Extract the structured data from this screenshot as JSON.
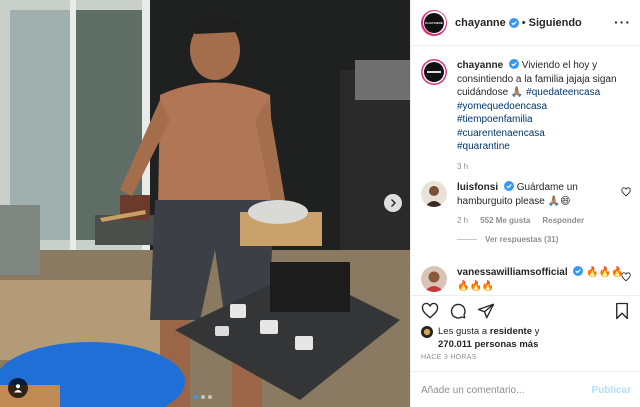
{
  "post": {
    "author": "chayanne",
    "avatar_text": "CHAYANNE",
    "follow_status": "Siguiendo",
    "separator": "•",
    "more_label": "···",
    "caption": {
      "author": "chayanne",
      "text": "Viviendo el hoy y consintiendo a la familia jajaja sigan cuidándose 🙏🏽",
      "hashtags": [
        "#quedateencasa",
        "#yomequedoencasa",
        "#tiempoenfamilia",
        "#cuarentenaencasa",
        "#quarantine"
      ],
      "time": "3 h"
    }
  },
  "comments": [
    {
      "author": "luisfonsi",
      "verified": true,
      "text": "Guárdame un hamburguito please 🙏🏽😄",
      "time": "2 h",
      "likes": "552 Me gusta",
      "reply_label": "Responder",
      "view_replies": "Ver respuestas (31)"
    },
    {
      "author": "vanessawilliamsofficial",
      "verified": true,
      "text": "🔥🔥🔥🔥🔥🔥"
    }
  ],
  "actions": {
    "liked_by_prefix": "Les gusta a",
    "liked_by_user": "residente",
    "liked_by_connector": "y",
    "liked_by_count": "270.011 personas más",
    "time_ago": "HACE 3 HORAS",
    "comment_placeholder": "Añade un comentario...",
    "publish_label": "Publicar"
  },
  "carousel": {
    "total": 3,
    "active": 1
  },
  "colors": {
    "link": "#00376b",
    "verified": "#3897f0",
    "muted": "#8e8e8e",
    "publish_disabled": "#b2dffc"
  }
}
